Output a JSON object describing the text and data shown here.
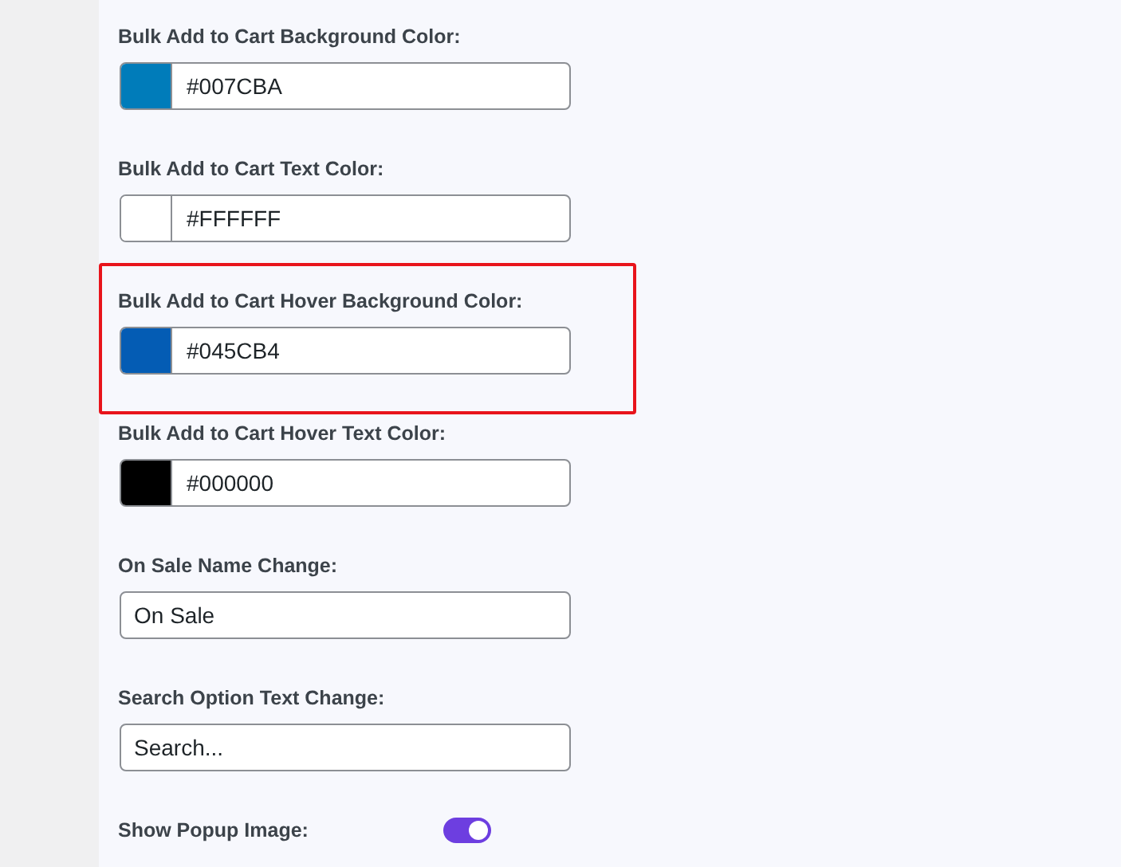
{
  "fields": [
    {
      "kind": "color",
      "label": "Bulk Add to Cart Background Color:",
      "color": "#007cba",
      "value": "#007CBA",
      "highlighted": false
    },
    {
      "kind": "color",
      "label": "Bulk Add to Cart Text Color:",
      "color": "#ffffff",
      "value": "#FFFFFF",
      "highlighted": false
    },
    {
      "kind": "color",
      "label": "Bulk Add to Cart Hover Background Color:",
      "color": "#045cb4",
      "value": "#045CB4",
      "highlighted": true
    },
    {
      "kind": "color",
      "label": "Bulk Add to Cart Hover Text Color:",
      "color": "#000000",
      "value": "#000000",
      "highlighted": false
    },
    {
      "kind": "text",
      "label": "On Sale Name Change:",
      "value": "On Sale",
      "highlighted": false
    },
    {
      "kind": "text",
      "label": "Search Option Text Change:",
      "value": "Search...",
      "highlighted": false
    },
    {
      "kind": "toggle",
      "label": "Show Popup Image:",
      "on": true,
      "highlighted": false
    }
  ]
}
